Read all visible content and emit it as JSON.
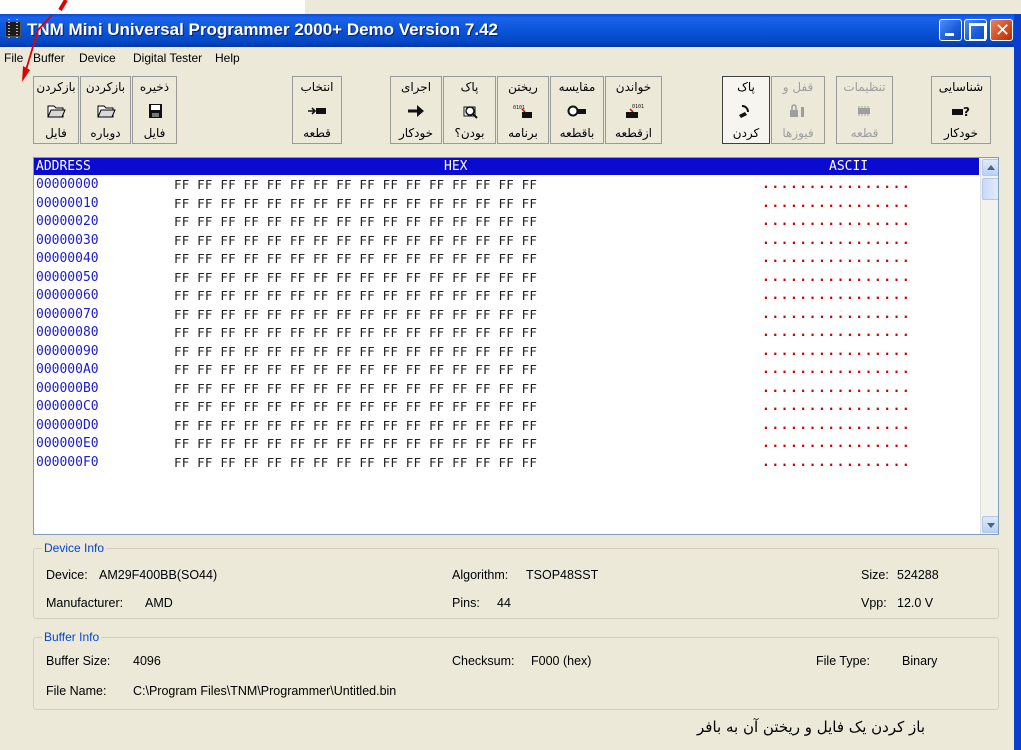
{
  "window": {
    "title": "TNM Mini Universal Programmer 2000+ Demo   Version 7.42"
  },
  "menu": [
    "File",
    "Buffer",
    "Device",
    "Digital Tester",
    "Help"
  ],
  "toolbar": [
    {
      "line1": "بازکردن",
      "line2": "فایل",
      "icon": "open-folder-icon"
    },
    {
      "line1": "بازکردن",
      "line2": "دوباره",
      "icon": "reopen-folder-icon"
    },
    {
      "line1": "ذخیره",
      "line2": "فایل",
      "icon": "save-disk-icon"
    },
    {
      "line1": "انتخاب",
      "line2": "قطعه",
      "icon": "select-chip-icon"
    },
    {
      "line1": "اجرای",
      "line2": "خودکار",
      "icon": "arrow-right-icon"
    },
    {
      "line1": "پاک",
      "line2": "بودن؟",
      "icon": "blank-check-icon"
    },
    {
      "line1": "ریختن",
      "line2": "برنامه",
      "icon": "program-chip-icon"
    },
    {
      "line1": "مقایسه",
      "line2": "باقطعه",
      "icon": "verify-glasses-icon"
    },
    {
      "line1": "خواندن",
      "line2": "ازقطعه",
      "icon": "read-chip-icon"
    },
    {
      "line1": "پاک",
      "line2": "کردن",
      "icon": "erase-icon"
    },
    {
      "line1": "قفل و",
      "line2": "فیوزها",
      "icon": "lock-fuse-icon"
    },
    {
      "line1": "تنظیمات",
      "line2": "قطعه",
      "icon": "chip-settings-icon"
    },
    {
      "line1": "شناسایی",
      "line2": "خودکار",
      "icon": "auto-detect-icon"
    }
  ],
  "hex": {
    "header": {
      "address": "ADDRESS",
      "hex": "HEX",
      "ascii": "ASCII"
    },
    "rows": [
      {
        "addr": "00000000",
        "bytes": "FF FF FF FF FF FF FF FF FF FF FF FF FF FF FF FF",
        "ascii": "................"
      },
      {
        "addr": "00000010",
        "bytes": "FF FF FF FF FF FF FF FF FF FF FF FF FF FF FF FF",
        "ascii": "................"
      },
      {
        "addr": "00000020",
        "bytes": "FF FF FF FF FF FF FF FF FF FF FF FF FF FF FF FF",
        "ascii": "................"
      },
      {
        "addr": "00000030",
        "bytes": "FF FF FF FF FF FF FF FF FF FF FF FF FF FF FF FF",
        "ascii": "................"
      },
      {
        "addr": "00000040",
        "bytes": "FF FF FF FF FF FF FF FF FF FF FF FF FF FF FF FF",
        "ascii": "................"
      },
      {
        "addr": "00000050",
        "bytes": "FF FF FF FF FF FF FF FF FF FF FF FF FF FF FF FF",
        "ascii": "................"
      },
      {
        "addr": "00000060",
        "bytes": "FF FF FF FF FF FF FF FF FF FF FF FF FF FF FF FF",
        "ascii": "................"
      },
      {
        "addr": "00000070",
        "bytes": "FF FF FF FF FF FF FF FF FF FF FF FF FF FF FF FF",
        "ascii": "................"
      },
      {
        "addr": "00000080",
        "bytes": "FF FF FF FF FF FF FF FF FF FF FF FF FF FF FF FF",
        "ascii": "................"
      },
      {
        "addr": "00000090",
        "bytes": "FF FF FF FF FF FF FF FF FF FF FF FF FF FF FF FF",
        "ascii": "................"
      },
      {
        "addr": "000000A0",
        "bytes": "FF FF FF FF FF FF FF FF FF FF FF FF FF FF FF FF",
        "ascii": "................"
      },
      {
        "addr": "000000B0",
        "bytes": "FF FF FF FF FF FF FF FF FF FF FF FF FF FF FF FF",
        "ascii": "................"
      },
      {
        "addr": "000000C0",
        "bytes": "FF FF FF FF FF FF FF FF FF FF FF FF FF FF FF FF",
        "ascii": "................"
      },
      {
        "addr": "000000D0",
        "bytes": "FF FF FF FF FF FF FF FF FF FF FF FF FF FF FF FF",
        "ascii": "................"
      },
      {
        "addr": "000000E0",
        "bytes": "FF FF FF FF FF FF FF FF FF FF FF FF FF FF FF FF",
        "ascii": "................"
      },
      {
        "addr": "000000F0",
        "bytes": "FF FF FF FF FF FF FF FF FF FF FF FF FF FF FF FF",
        "ascii": "................"
      }
    ]
  },
  "device_info": {
    "legend": "Device Info",
    "device_label": "Device:",
    "device": "AM29F400BB(SO44)",
    "algorithm_label": "Algorithm:",
    "algorithm": "TSOP48SST",
    "size_label": "Size:",
    "size": "524288",
    "manufacturer_label": "Manufacturer:",
    "manufacturer": "AMD",
    "pins_label": "Pins:",
    "pins": "44",
    "vpp_label": "Vpp:",
    "vpp": "12.0 V"
  },
  "buffer_info": {
    "legend": "Buffer Info",
    "buffer_size_label": "Buffer Size:",
    "buffer_size": "4096",
    "checksum_label": "Checksum:",
    "checksum": "F000 (hex)",
    "file_type_label": "File Type:",
    "file_type": "Binary",
    "file_name_label": "File Name:",
    "file_name": "C:\\Program Files\\TNM\\Programmer\\Untitled.bin"
  },
  "caption": "باز کردن یک فایل و ریختن آن به بافر",
  "colors": {
    "hex_header_bg": "#0a0ad0",
    "address_text": "#1c1ccf",
    "ascii_text": "#d00000",
    "annotation_arrow": "#e00000"
  }
}
